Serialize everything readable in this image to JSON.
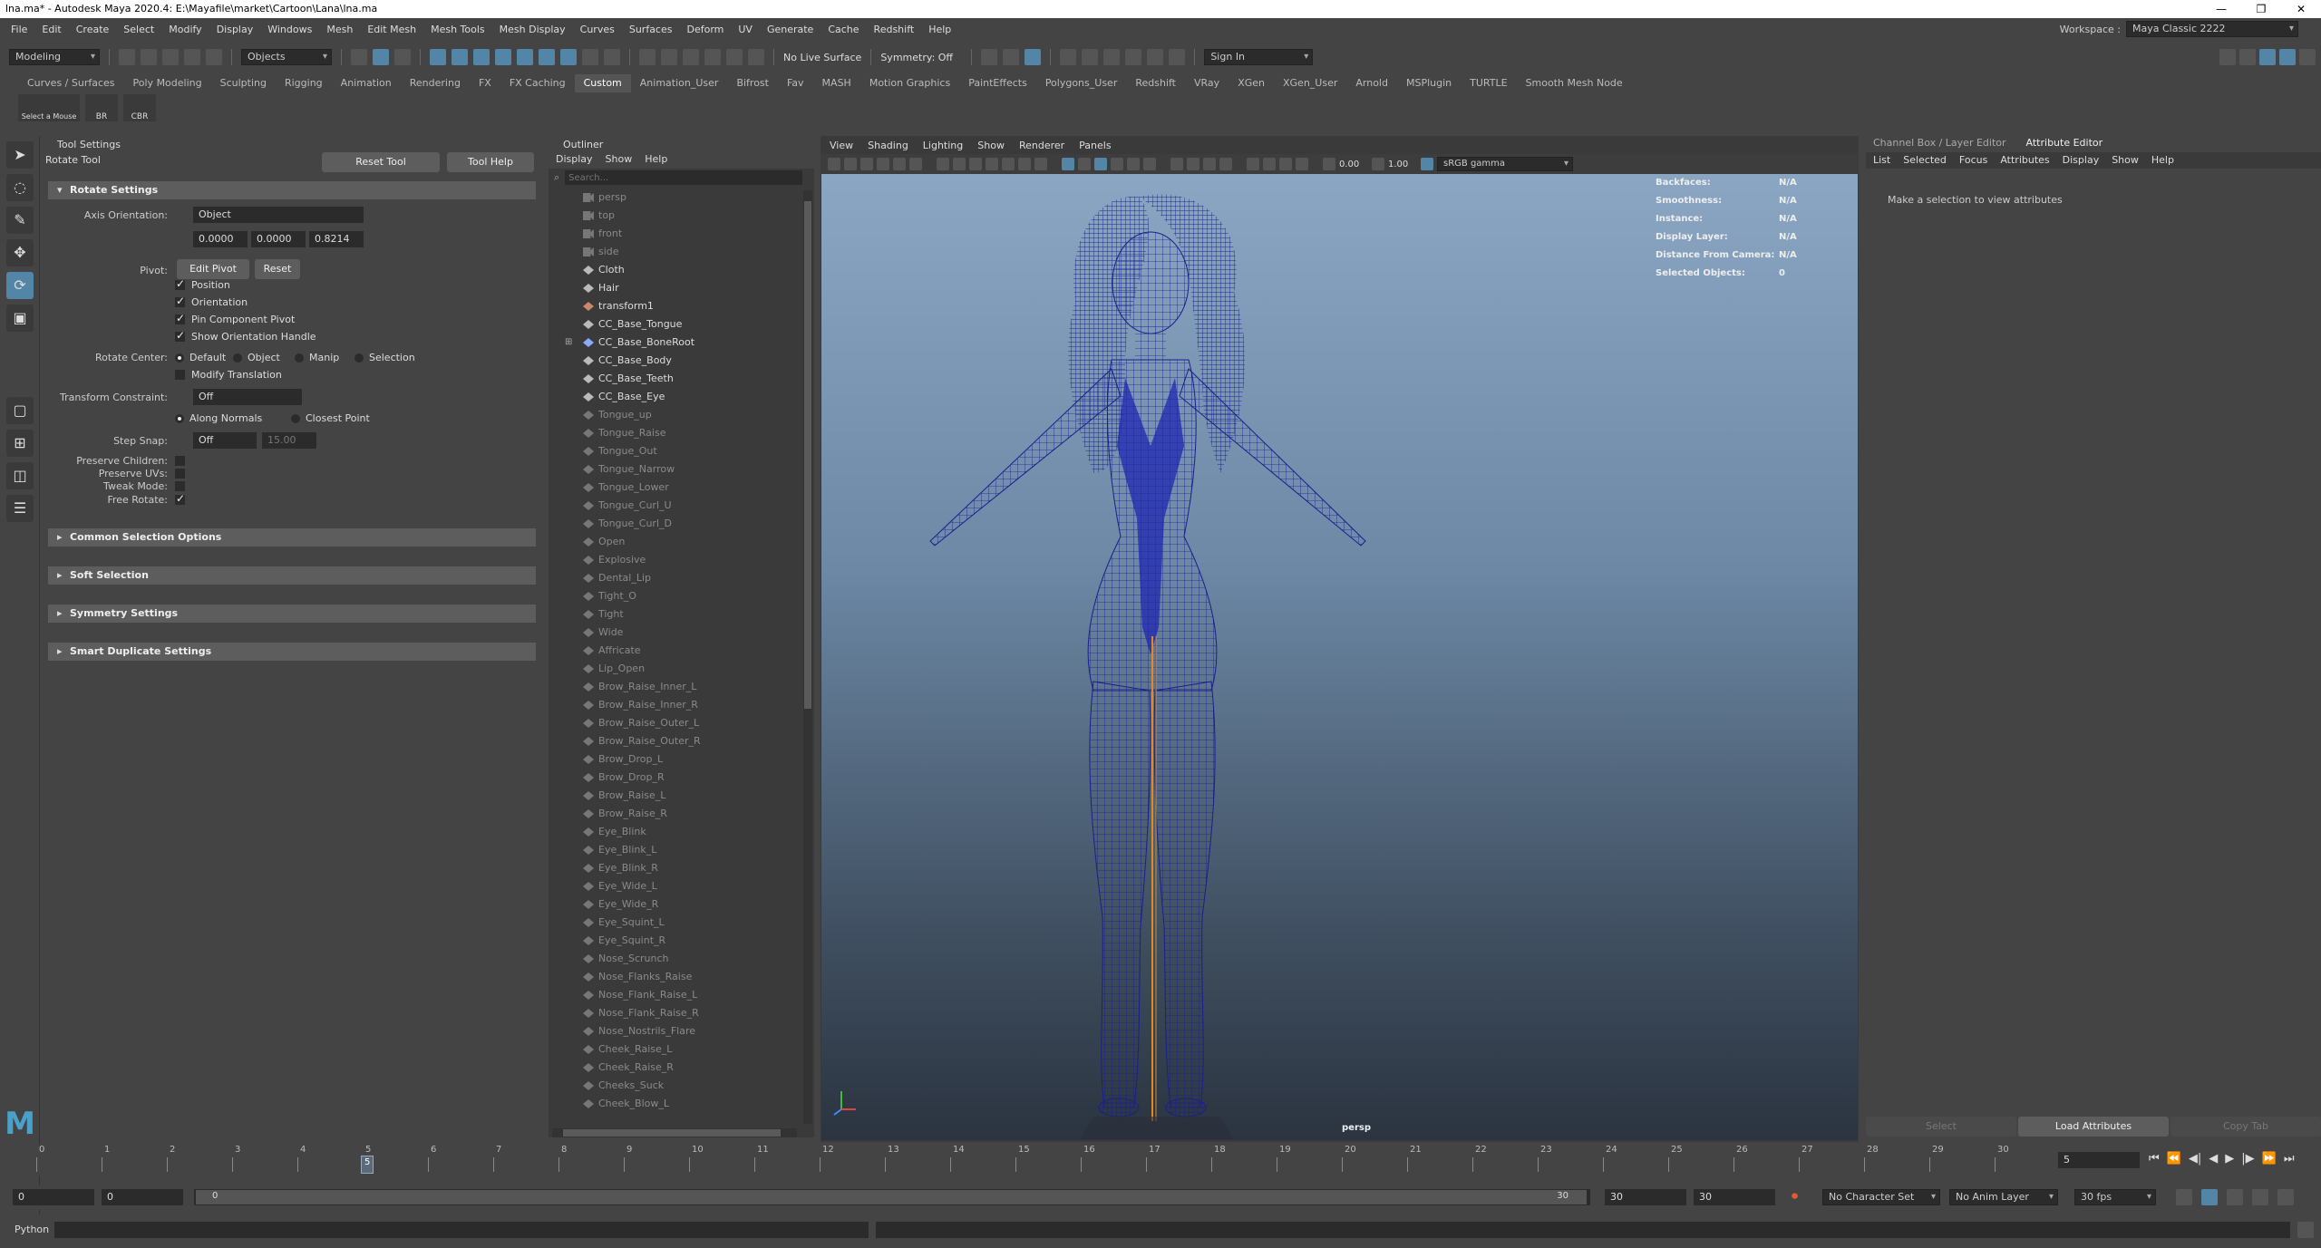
{
  "window": {
    "title": "lna.ma* - Autodesk Maya 2020.4: E:\\Mayafile\\market\\Cartoon\\Lana\\lna.ma"
  },
  "menu": [
    "File",
    "Edit",
    "Create",
    "Select",
    "Modify",
    "Display",
    "Windows",
    "Mesh",
    "Edit Mesh",
    "Mesh Tools",
    "Mesh Display",
    "Curves",
    "Surfaces",
    "Deform",
    "UV",
    "Generate",
    "Cache",
    "Redshift",
    "Help"
  ],
  "workspace": {
    "label": "Workspace :",
    "value": "Maya Classic 2222"
  },
  "status": {
    "mode": "Modeling",
    "select_mode": "Objects",
    "live_surface": "No Live Surface",
    "symmetry": "Symmetry: Off",
    "sign_in": "Sign In"
  },
  "shelf": {
    "tabs": [
      "Curves / Surfaces",
      "Poly Modeling",
      "Sculpting",
      "Rigging",
      "Animation",
      "Rendering",
      "FX",
      "FX Caching",
      "Custom",
      "Animation_User",
      "Bifrost",
      "Fav",
      "MASH",
      "Motion Graphics",
      "PaintEffects",
      "Polygons_User",
      "Redshift",
      "VRay",
      "XGen",
      "XGen_User",
      "Arnold",
      "MSPlugin",
      "TURTLE",
      "Smooth Mesh Node"
    ],
    "active": "Custom",
    "icons": [
      "Select a Mouse",
      "BR",
      "CBR"
    ]
  },
  "tool_settings": {
    "panel_title": "Tool Settings",
    "tool_name": "Rotate Tool",
    "reset_tool": "Reset Tool",
    "tool_help": "Tool Help",
    "section_rotate": "Rotate Settings",
    "axis_orientation_label": "Axis Orientation:",
    "axis_orientation_value": "Object",
    "axis_values": [
      "0.0000",
      "0.0000",
      "0.8214"
    ],
    "pivot_label": "Pivot:",
    "edit_pivot": "Edit Pivot",
    "reset": "Reset",
    "pivot_checks": [
      "Position",
      "Orientation",
      "Pin Component Pivot",
      "Show Orientation Handle"
    ],
    "rotate_center_label": "Rotate Center:",
    "rotate_center_options": [
      "Default",
      "Object",
      "Manip",
      "Selection"
    ],
    "modify_translation": "Modify Translation",
    "transform_constraint_label": "Transform Constraint:",
    "transform_constraint_value": "Off",
    "along_normals": "Along Normals",
    "closest_point": "Closest Point",
    "step_snap_label": "Step Snap:",
    "step_snap_value": "Off",
    "step_snap_amount": "15.00",
    "preserve_children": "Preserve Children:",
    "preserve_uvs": "Preserve UVs:",
    "tweak_mode": "Tweak Mode:",
    "free_rotate": "Free Rotate:",
    "sections": [
      "Common Selection Options",
      "Soft Selection",
      "Symmetry Settings",
      "Smart Duplicate Settings"
    ]
  },
  "outliner": {
    "title": "Outliner",
    "menu": [
      "Display",
      "Show",
      "Help"
    ],
    "search_placeholder": "Search...",
    "items": [
      {
        "name": "persp",
        "dim": true,
        "icon": "camera"
      },
      {
        "name": "top",
        "dim": true,
        "icon": "camera"
      },
      {
        "name": "front",
        "dim": true,
        "icon": "camera"
      },
      {
        "name": "side",
        "dim": true,
        "icon": "camera"
      },
      {
        "name": "Cloth",
        "dim": false,
        "icon": "mesh"
      },
      {
        "name": "Hair",
        "dim": false,
        "icon": "mesh"
      },
      {
        "name": "transform1",
        "dim": false,
        "icon": "transform"
      },
      {
        "name": "CC_Base_Tongue",
        "dim": false,
        "icon": "mesh"
      },
      {
        "name": "CC_Base_BoneRoot",
        "dim": false,
        "icon": "joint"
      },
      {
        "name": "CC_Base_Body",
        "dim": false,
        "icon": "mesh"
      },
      {
        "name": "CC_Base_Teeth",
        "dim": false,
        "icon": "mesh"
      },
      {
        "name": "CC_Base_Eye",
        "dim": false,
        "icon": "mesh"
      },
      {
        "name": "Tongue_up",
        "dim": true,
        "icon": "mesh"
      },
      {
        "name": "Tongue_Raise",
        "dim": true,
        "icon": "mesh"
      },
      {
        "name": "Tongue_Out",
        "dim": true,
        "icon": "mesh"
      },
      {
        "name": "Tongue_Narrow",
        "dim": true,
        "icon": "mesh"
      },
      {
        "name": "Tongue_Lower",
        "dim": true,
        "icon": "mesh"
      },
      {
        "name": "Tongue_Curl_U",
        "dim": true,
        "icon": "mesh"
      },
      {
        "name": "Tongue_Curl_D",
        "dim": true,
        "icon": "mesh"
      },
      {
        "name": "Open",
        "dim": true,
        "icon": "mesh"
      },
      {
        "name": "Explosive",
        "dim": true,
        "icon": "mesh"
      },
      {
        "name": "Dental_Lip",
        "dim": true,
        "icon": "mesh"
      },
      {
        "name": "Tight_O",
        "dim": true,
        "icon": "mesh"
      },
      {
        "name": "Tight",
        "dim": true,
        "icon": "mesh"
      },
      {
        "name": "Wide",
        "dim": true,
        "icon": "mesh"
      },
      {
        "name": "Affricate",
        "dim": true,
        "icon": "mesh"
      },
      {
        "name": "Lip_Open",
        "dim": true,
        "icon": "mesh"
      },
      {
        "name": "Brow_Raise_Inner_L",
        "dim": true,
        "icon": "mesh"
      },
      {
        "name": "Brow_Raise_Inner_R",
        "dim": true,
        "icon": "mesh"
      },
      {
        "name": "Brow_Raise_Outer_L",
        "dim": true,
        "icon": "mesh"
      },
      {
        "name": "Brow_Raise_Outer_R",
        "dim": true,
        "icon": "mesh"
      },
      {
        "name": "Brow_Drop_L",
        "dim": true,
        "icon": "mesh"
      },
      {
        "name": "Brow_Drop_R",
        "dim": true,
        "icon": "mesh"
      },
      {
        "name": "Brow_Raise_L",
        "dim": true,
        "icon": "mesh"
      },
      {
        "name": "Brow_Raise_R",
        "dim": true,
        "icon": "mesh"
      },
      {
        "name": "Eye_Blink",
        "dim": true,
        "icon": "mesh"
      },
      {
        "name": "Eye_Blink_L",
        "dim": true,
        "icon": "mesh"
      },
      {
        "name": "Eye_Blink_R",
        "dim": true,
        "icon": "mesh"
      },
      {
        "name": "Eye_Wide_L",
        "dim": true,
        "icon": "mesh"
      },
      {
        "name": "Eye_Wide_R",
        "dim": true,
        "icon": "mesh"
      },
      {
        "name": "Eye_Squint_L",
        "dim": true,
        "icon": "mesh"
      },
      {
        "name": "Eye_Squint_R",
        "dim": true,
        "icon": "mesh"
      },
      {
        "name": "Nose_Scrunch",
        "dim": true,
        "icon": "mesh"
      },
      {
        "name": "Nose_Flanks_Raise",
        "dim": true,
        "icon": "mesh"
      },
      {
        "name": "Nose_Flank_Raise_L",
        "dim": true,
        "icon": "mesh"
      },
      {
        "name": "Nose_Flank_Raise_R",
        "dim": true,
        "icon": "mesh"
      },
      {
        "name": "Nose_Nostrils_Flare",
        "dim": true,
        "icon": "mesh"
      },
      {
        "name": "Cheek_Raise_L",
        "dim": true,
        "icon": "mesh"
      },
      {
        "name": "Cheek_Raise_R",
        "dim": true,
        "icon": "mesh"
      },
      {
        "name": "Cheeks_Suck",
        "dim": true,
        "icon": "mesh"
      },
      {
        "name": "Cheek_Blow_L",
        "dim": true,
        "icon": "mesh"
      }
    ]
  },
  "viewport": {
    "menu": [
      "View",
      "Shading",
      "Lighting",
      "Show",
      "Renderer",
      "Panels"
    ],
    "exposure": "0.00",
    "gamma": "1.00",
    "color_space": "sRGB gamma",
    "camera_label": "persp",
    "hud": [
      {
        "k": "Backfaces:",
        "v": "N/A"
      },
      {
        "k": "Smoothness:",
        "v": "N/A"
      },
      {
        "k": "Instance:",
        "v": "N/A"
      },
      {
        "k": "Display Layer:",
        "v": "N/A"
      },
      {
        "k": "Distance From Camera:",
        "v": "N/A"
      },
      {
        "k": "Selected Objects:",
        "v": "0"
      }
    ]
  },
  "attribute_editor": {
    "tabs": [
      "Channel Box / Layer Editor",
      "Attribute Editor"
    ],
    "menu": [
      "List",
      "Selected",
      "Focus",
      "Attributes",
      "Display",
      "Show",
      "Help"
    ],
    "message": "Make a selection to view attributes",
    "buttons": [
      "Select",
      "Load Attributes",
      "Copy Tab"
    ]
  },
  "timeline": {
    "ticks": [
      "0",
      "1",
      "2",
      "3",
      "4",
      "5",
      "6",
      "7",
      "8",
      "9",
      "10",
      "11",
      "12",
      "13",
      "14",
      "15",
      "16",
      "17",
      "18",
      "19",
      "20",
      "21",
      "22",
      "23",
      "24",
      "25",
      "26",
      "27",
      "28",
      "29",
      "30"
    ],
    "current_frame": "5",
    "current_frame_field": "5"
  },
  "range": {
    "start": "0",
    "anim_start": "0",
    "slider_start": "0",
    "slider_end": "30",
    "end": "30",
    "anim_end": "30",
    "character_set": "No Character Set",
    "anim_layer": "No Anim Layer",
    "fps": "30 fps"
  },
  "command_line": {
    "label": "Python"
  }
}
